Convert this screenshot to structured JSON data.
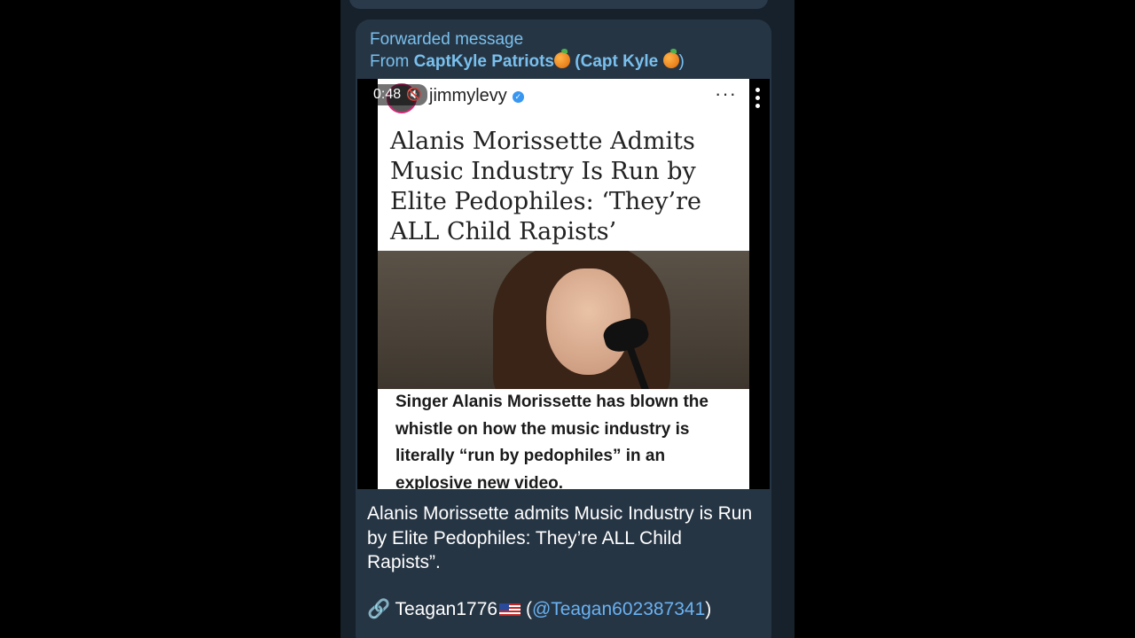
{
  "message": {
    "forwarded_label": "Forwarded message",
    "from_prefix": "From ",
    "from_channel": "CaptKyle Patriots",
    "from_author": "(Capt Kyle",
    "from_close": ")",
    "video": {
      "duration": "0:48",
      "ig_username": "jimmylevy",
      "ig_headline": "Alanis Morissette Admits Music Industry Is Run by Elite Pedophiles: ‘They’re ALL Child Rapists’",
      "ig_caption": "Singer Alanis Morissette has blown the whistle on how the music industry is literally “run by pedophiles” in an explosive new video."
    },
    "text": "Alanis Morissette admits Music Industry is Run by Elite Pedophiles: They’re ALL Child Rapists”.",
    "source_name": "Teagan1776",
    "source_handle_open": "(",
    "source_handle": "@Teagan602387341",
    "source_handle_close": ")"
  },
  "icons": {
    "orange": "tangerine-emoji",
    "link": "link-emoji",
    "flag": "us-flag-emoji",
    "mute": "speaker-muted-icon",
    "verified": "verified-badge-icon"
  },
  "colors": {
    "chat_background": "#17212b",
    "bubble": "#263544",
    "link_blue": "#79c0ee",
    "mention": "#6ab2f2"
  }
}
